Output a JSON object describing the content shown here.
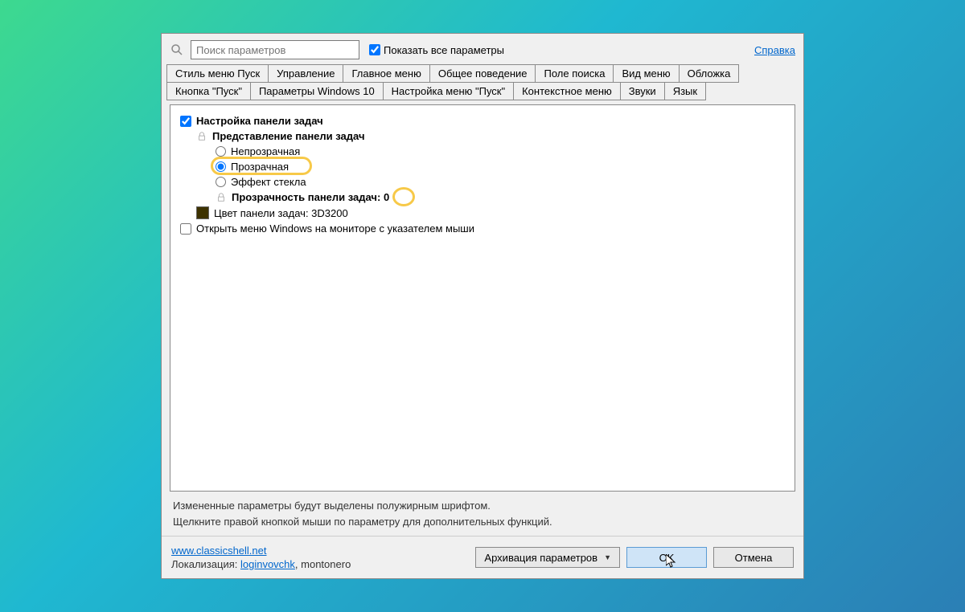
{
  "search": {
    "placeholder": "Поиск параметров"
  },
  "showall_label": "Показать все параметры",
  "help_label": "Справка",
  "tabs_row1": [
    "Стиль меню Пуск",
    "Управление",
    "Главное меню",
    "Общее поведение",
    "Поле поиска",
    "Вид меню",
    "Обложка"
  ],
  "tabs_row2": [
    "Кнопка \"Пуск\"",
    "Параметры Windows 10",
    "Настройка меню \"Пуск\"",
    "Контекстное меню",
    "Звуки",
    "Язык"
  ],
  "tree": {
    "taskbar_settings": "Настройка панели задач",
    "presentation": "Представление панели задач",
    "opt_opaque": "Непрозрачная",
    "opt_transparent": "Прозрачная",
    "opt_glass": "Эффект стекла",
    "transparency_label": "Прозрачность панели задач: ",
    "transparency_value": "0",
    "color_label": "Цвет панели задач: 3D3200",
    "open_on_monitor": "Открыть меню Windows на мониторе с указателем мыши"
  },
  "hints": {
    "line1": "Измененные параметры будут выделены полужирным шрифтом.",
    "line2": "Щелкните правой кнопкой мыши по параметру для дополнительных функций."
  },
  "footer": {
    "site": "www.classicshell.net",
    "loc_label": "Локализация: ",
    "loc_author": "loginvovchk",
    "loc_sep": ", montonero",
    "archive": "Архивация параметров",
    "ok": "OK",
    "cancel": "Отмена"
  }
}
